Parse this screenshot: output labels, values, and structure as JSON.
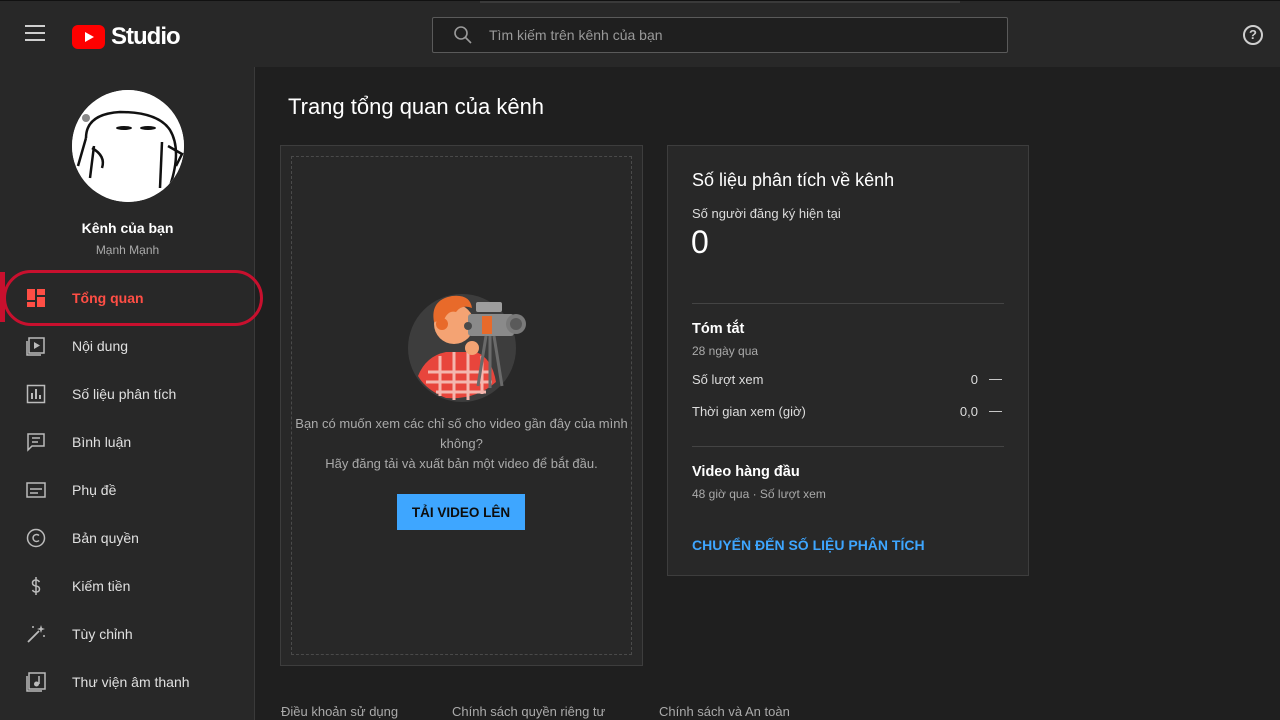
{
  "header": {
    "logo_text": "Studio",
    "search_placeholder": "Tìm kiếm trên kênh của bạn",
    "help_icon": "?"
  },
  "sidebar": {
    "channel_title": "Kênh của bạn",
    "channel_name": "Mạnh Mạnh",
    "items": [
      {
        "label": "Tổng quan",
        "icon": "dashboard-icon",
        "active": true
      },
      {
        "label": "Nội dung",
        "icon": "content-icon"
      },
      {
        "label": "Số liệu phân tích",
        "icon": "analytics-icon"
      },
      {
        "label": "Bình luận",
        "icon": "comments-icon"
      },
      {
        "label": "Phụ đề",
        "icon": "subtitles-icon"
      },
      {
        "label": "Bản quyền",
        "icon": "copyright-icon"
      },
      {
        "label": "Kiếm tiền",
        "icon": "monetization-icon"
      },
      {
        "label": "Tùy chỉnh",
        "icon": "customization-icon"
      },
      {
        "label": "Thư viện âm thanh",
        "icon": "audio-library-icon"
      }
    ]
  },
  "main": {
    "page_title": "Trang tổng quan của kênh",
    "upload_card": {
      "prompt_line1": "Bạn có muốn xem các chỉ số cho video gần đây của mình không?",
      "prompt_line2": "Hãy đăng tải và xuất bản một video để bắt đầu.",
      "button_label": "TẢI VIDEO LÊN"
    },
    "analytics_card": {
      "title": "Số liệu phân tích về kênh",
      "subscribers_label": "Số người đăng ký hiện tại",
      "subscribers_count": "0",
      "summary_title": "Tóm tắt",
      "summary_period": "28 ngày qua",
      "metrics": [
        {
          "label": "Số lượt xem",
          "value": "0",
          "trend": "—"
        },
        {
          "label": "Thời gian xem (giờ)",
          "value": "0,0",
          "trend": "—"
        }
      ],
      "top_videos_title": "Video hàng đầu",
      "top_videos_sub": "48 giờ qua · Số lượt xem",
      "link_label": "CHUYỂN ĐẾN SỐ LIỆU PHÂN TÍCH"
    }
  },
  "footer": {
    "links": [
      "Điều khoản sử dụng",
      "Chính sách quyền riêng tư",
      "Chính sách và An toàn"
    ]
  },
  "colors": {
    "accent_red": "#ff4e45",
    "link_blue": "#3ea6ff",
    "highlight_ring": "#c8102e"
  }
}
